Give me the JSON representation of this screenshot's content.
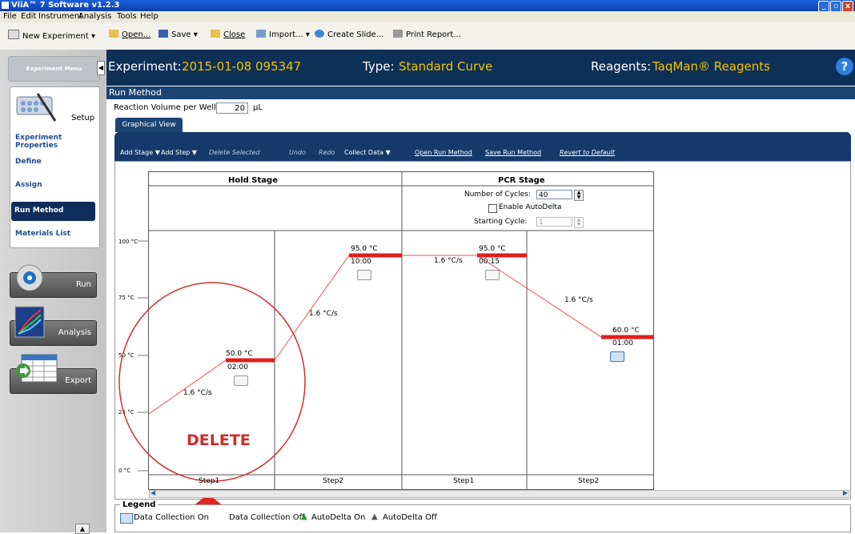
{
  "window": {
    "title": "ViiA™ 7 Software v1.2.3"
  },
  "menu": [
    "File",
    "Edit",
    "Instrument",
    "Analysis",
    "Tools",
    "Help"
  ],
  "toolbar": {
    "new_experiment": "New Experiment",
    "open": "Open...",
    "save": "Save",
    "close": "Close",
    "import": "Import...",
    "create_slide": "Create Slide...",
    "print_report": "Print Report..."
  },
  "sidebar": {
    "experiment_menu": "Experiment Menu",
    "setup_label": "Setup",
    "items": [
      {
        "label": "Experiment Properties"
      },
      {
        "label": "Define"
      },
      {
        "label": "Assign"
      },
      {
        "label": "Run Method"
      },
      {
        "label": "Materials List"
      }
    ],
    "run_label": "Run",
    "analysis_label": "Analysis",
    "export_label": "Export"
  },
  "header": {
    "experiment_label": "Experiment:",
    "experiment_value": "2015-01-08 095347",
    "type_label": "Type:",
    "type_value": "Standard Curve",
    "reagents_label": "Reagents:",
    "reagents_value": "TaqMan® Reagents",
    "help": "?",
    "accent_color": "#f2c200"
  },
  "run_method": {
    "title": "Run Method",
    "reaction_volume_label": "Reaction Volume per Well:",
    "reaction_volume_value": "20",
    "reaction_volume_unit": "µL",
    "tab": "Graphical View"
  },
  "graph_toolbar": {
    "add_stage": "Add Stage ▼",
    "add_step": "Add Step ▼",
    "delete_selected": "Delete Selected",
    "undo": "Undo",
    "redo": "Redo",
    "collect_data": "Collect Data ▼",
    "open_run_method": "Open Run Method",
    "save_run_method": "Save Run Method",
    "revert": "Revert to Default"
  },
  "y_axis": [
    "100 °C",
    "75 °C",
    "50 °C",
    "25 °C",
    "0 °C"
  ],
  "hold_stage": {
    "title": "Hold Stage",
    "step1": {
      "name": "Step1",
      "temp": "50.0 °C",
      "time": "02:00",
      "rate": "1.6 °C/s"
    },
    "step2": {
      "name": "Step2",
      "temp": "95.0 °C",
      "time": "10:00",
      "rate": "1.6 °C/s"
    }
  },
  "pcr_stage": {
    "title": "PCR Stage",
    "cycles_label": "Number of Cycles:",
    "cycles_value": "40",
    "autodelta_label": "Enable AutoDelta",
    "starting_cycle_label": "Starting Cycle:",
    "starting_cycle_value": "1",
    "step1": {
      "name": "Step1",
      "temp": "95.0 °C",
      "time": "00:15",
      "rate": "1.6 °C/s"
    },
    "step2": {
      "name": "Step2",
      "temp": "60.0 °C",
      "time": "01:00",
      "rate": "1.6 °C/s"
    }
  },
  "legend": {
    "title": "Legend",
    "items": [
      "Data Collection On",
      "Data Collection Off",
      "AutoDelta On",
      "AutoDelta Off"
    ]
  },
  "annotation": {
    "text": "DELETE",
    "color": "#d12a2a"
  }
}
